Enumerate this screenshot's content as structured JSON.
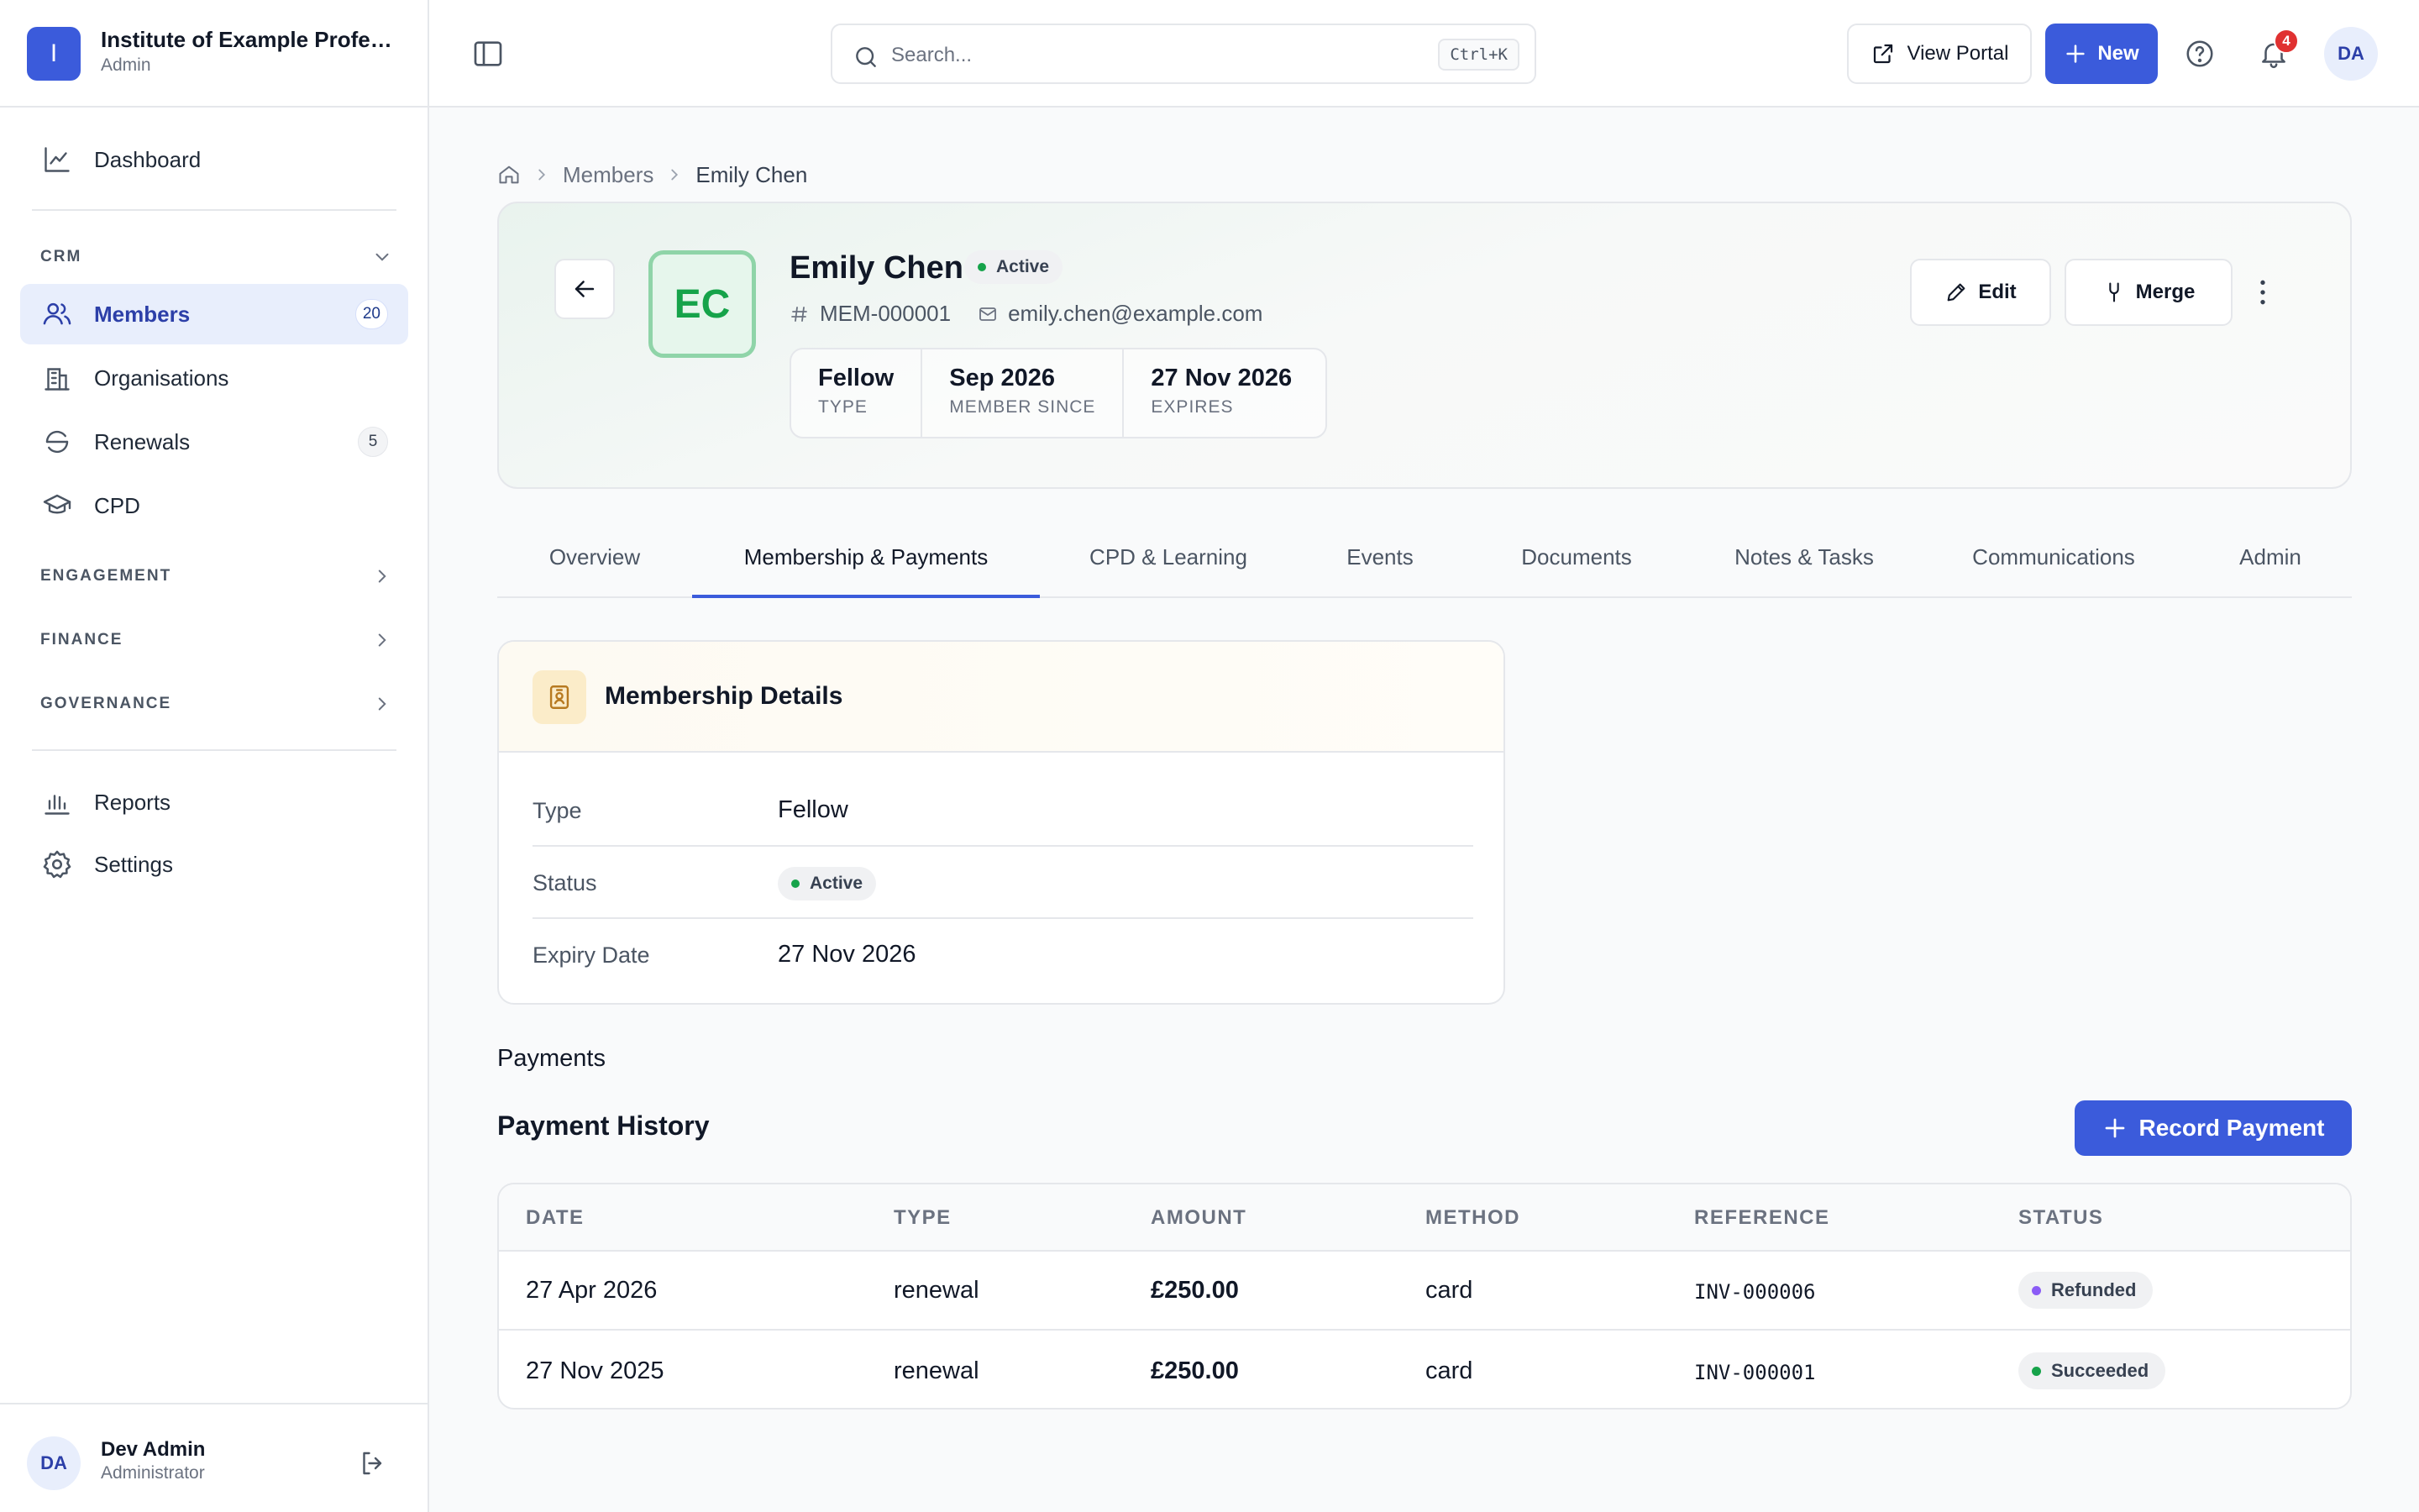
{
  "org": {
    "logo_letter": "I",
    "name": "Institute of Example Professi…",
    "role": "Admin"
  },
  "sidebar": {
    "dashboard": "Dashboard",
    "crm_label": "CRM",
    "items": [
      {
        "label": "Members",
        "count": "20"
      },
      {
        "label": "Organisations"
      },
      {
        "label": "Renewals",
        "count": "5"
      },
      {
        "label": "CPD"
      }
    ],
    "sections": [
      "ENGAGEMENT",
      "FINANCE",
      "GOVERNANCE"
    ],
    "reports": "Reports",
    "settings": "Settings"
  },
  "user": {
    "initials": "DA",
    "name": "Dev Admin",
    "role": "Administrator"
  },
  "header": {
    "search_placeholder": "Search...",
    "search_shortcut": "Ctrl+K",
    "view_portal": "View Portal",
    "new_label": "New",
    "notification_count": "4",
    "avatar": "DA"
  },
  "breadcrumb": {
    "parent": "Members",
    "current": "Emily Chen"
  },
  "member": {
    "initials": "EC",
    "name": "Emily Chen",
    "status": "Active",
    "id": "MEM-000001",
    "email": "emily.chen@example.com",
    "stats": [
      {
        "value": "Fellow",
        "key": "TYPE"
      },
      {
        "value": "Sep 2026",
        "key": "MEMBER SINCE"
      },
      {
        "value": "27 Nov 2026",
        "key": "EXPIRES"
      }
    ],
    "edit_label": "Edit",
    "merge_label": "Merge"
  },
  "tabs": [
    "Overview",
    "Membership & Payments",
    "CPD & Learning",
    "Events",
    "Documents",
    "Notes & Tasks",
    "Communications",
    "Admin"
  ],
  "active_tab": "Membership & Payments",
  "membership": {
    "title": "Membership Details",
    "rows": [
      {
        "label": "Type",
        "value": "Fellow"
      },
      {
        "label": "Status",
        "value": "Active"
      },
      {
        "label": "Expiry Date",
        "value": "27 Nov 2026"
      }
    ]
  },
  "payments": {
    "section_label": "Payments",
    "title": "Payment History",
    "record_label": "Record Payment",
    "columns": [
      "DATE",
      "TYPE",
      "AMOUNT",
      "METHOD",
      "REFERENCE",
      "STATUS"
    ],
    "rows": [
      {
        "date": "27 Apr 2026",
        "type": "renewal",
        "amount": "£250.00",
        "method": "card",
        "reference": "INV-000006",
        "status": "Refunded",
        "status_color": "#8b5cf6"
      },
      {
        "date": "27 Nov 2025",
        "type": "renewal",
        "amount": "£250.00",
        "method": "card",
        "reference": "INV-000001",
        "status": "Succeeded",
        "status_color": "#16a34a"
      }
    ]
  },
  "colors": {
    "accent": "#3b5bdb",
    "active_green": "#16a34a",
    "refunded": "#8b5cf6",
    "danger": "#e03131"
  }
}
